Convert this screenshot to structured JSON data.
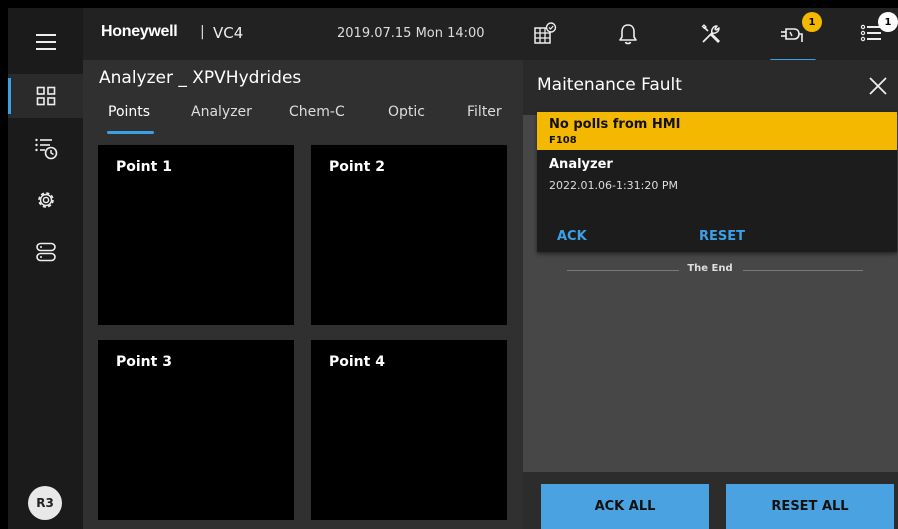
{
  "sidebar": {
    "icons": [
      "hamburger-menu-icon",
      "dashboard-grid-icon",
      "history-list-icon",
      "settings-gear-icon",
      "hardware-modules-icon"
    ],
    "user": "R3"
  },
  "topbar": {
    "brand": "Honeywell",
    "separator": "|",
    "product": "VC4",
    "datetime": "2019.07.15 Mon 14:00",
    "maintenance_badge": "1",
    "list_badge": "1"
  },
  "main": {
    "title": "Analyzer _ XPVHydrides",
    "tabs": [
      {
        "label": "Points"
      },
      {
        "label": "Analyzer"
      },
      {
        "label": "Chem-C"
      },
      {
        "label": "Optic"
      },
      {
        "label": "Filter"
      }
    ],
    "points": [
      {
        "label": "Point 1"
      },
      {
        "label": "Point 2"
      },
      {
        "label": "Point 3"
      },
      {
        "label": "Point 4"
      }
    ]
  },
  "panel": {
    "title": "Maitenance Fault",
    "fault": {
      "title": "No polls from HMI",
      "code": "F108",
      "source": "Analyzer",
      "time": "2022.01.06-1:31:20 PM",
      "ack_label": "ACK",
      "reset_label": "RESET"
    },
    "end_text": "The End",
    "ack_all_label": "ACK ALL",
    "reset_all_label": "RESET ALL"
  },
  "colors": {
    "accent": "#3ba0e6",
    "warning": "#f5b800",
    "button": "#4aa3e0"
  }
}
